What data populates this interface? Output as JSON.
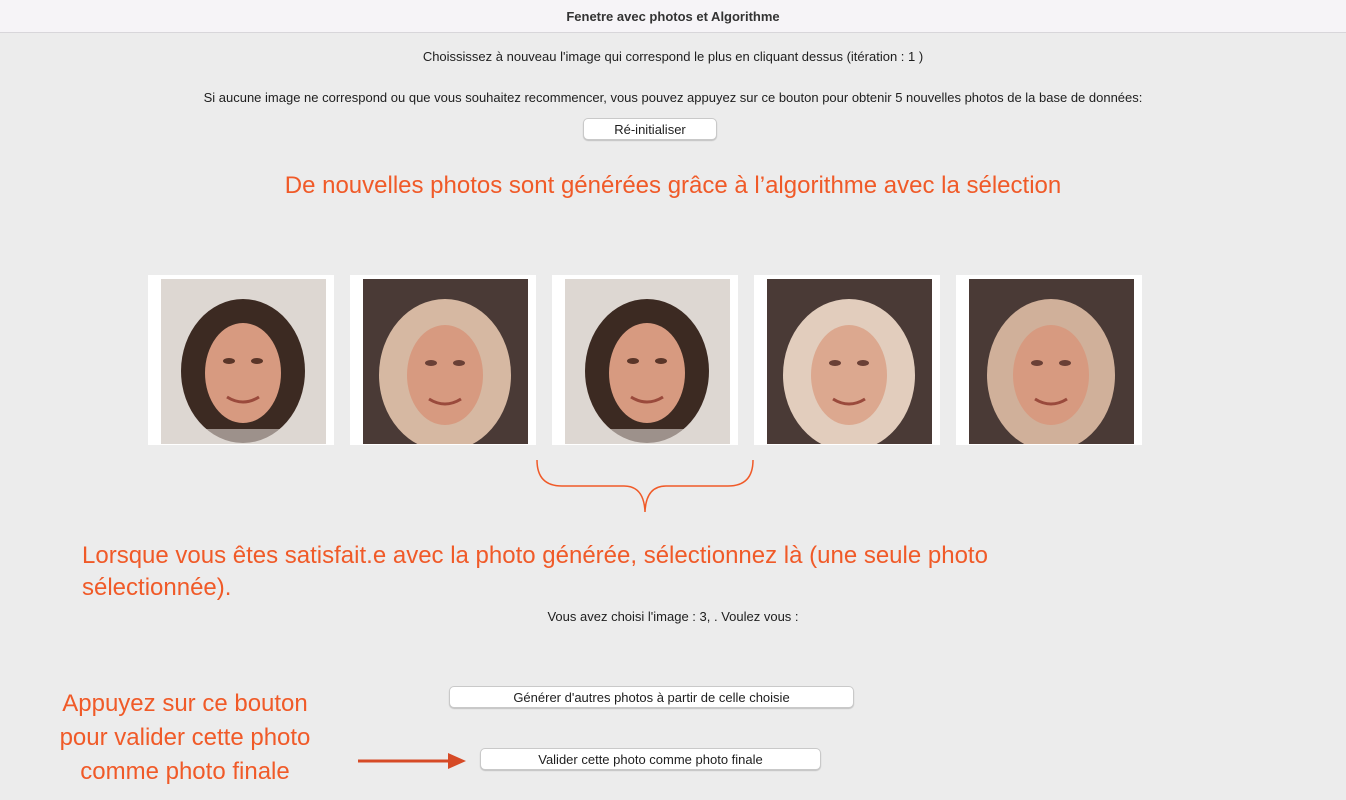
{
  "window": {
    "title": "Fenetre avec photos et  Algorithme"
  },
  "header": {
    "instruction": "Choississez à nouveau l'image qui correspond le plus en cliquant dessus (itération : 1 )",
    "reset_hint": "Si aucune image ne correspond ou que vous souhaitez recommencer, vous pouvez appuyez sur ce bouton pour obtenir 5 nouvelles photos de la base de données:",
    "reset_label": "Ré-initialiser"
  },
  "annotations": {
    "generated": "De nouvelles photos sont générées grâce à l’algorithme avec la sélection",
    "satisfied_line1": "Lorsque vous êtes satisfait.e avec la photo générée, sélectionnez là (une seule photo",
    "satisfied_line2": "sélectionnée).",
    "validate_line1": "Appuyez sur ce bouton",
    "validate_line2": "pour valider cette photo",
    "validate_line3": "comme photo finale"
  },
  "selection": {
    "status": "Vous avez choisi l'image : 3, . Voulez vous :",
    "generate_label": "Générer d'autres photos à partir de celle choisie",
    "validate_label": "Valider cette photo comme photo finale"
  },
  "photos": [
    {
      "hair": "dark"
    },
    {
      "hair": "blond"
    },
    {
      "hair": "dark"
    },
    {
      "hair": "blond"
    },
    {
      "hair": "blond"
    }
  ],
  "colors": {
    "accent": "#f05a28",
    "background": "#ececec",
    "dark_hair": "#3c2a22",
    "blond_hair": "#d6b8a2",
    "skin": "#d79a80"
  }
}
